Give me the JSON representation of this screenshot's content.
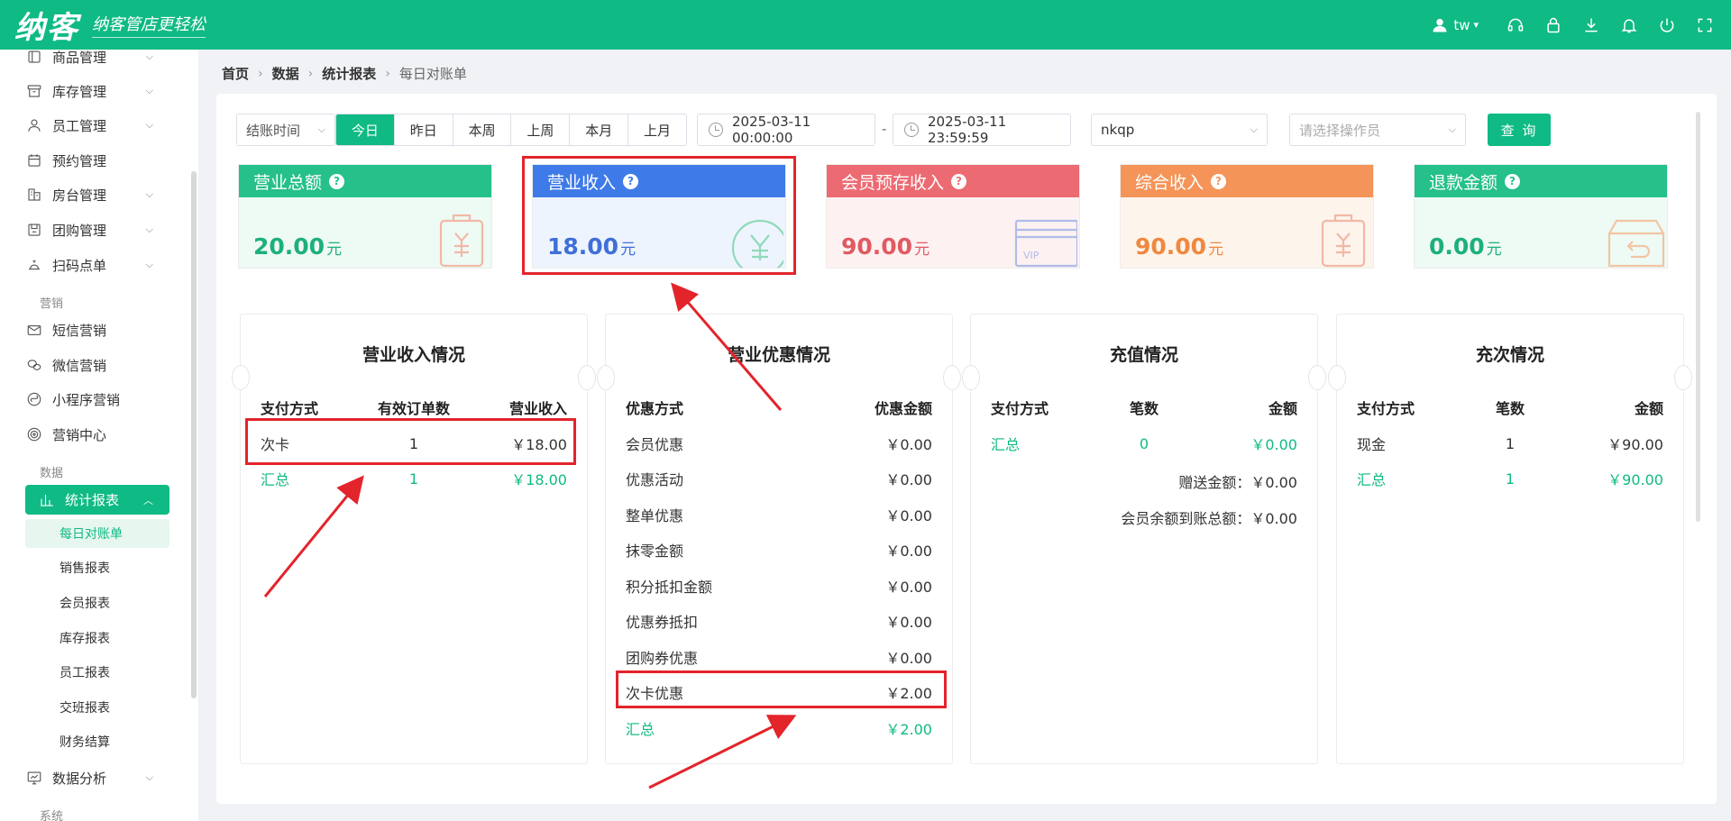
{
  "app": {
    "logo": "纳客",
    "slogan": "纳客管店更轻松",
    "user": "tw"
  },
  "sidebar": {
    "items_top": [
      {
        "label": "商品管理",
        "icon": "box-icon"
      },
      {
        "label": "库存管理",
        "icon": "warehouse-icon"
      },
      {
        "label": "员工管理",
        "icon": "user-icon"
      },
      {
        "label": "预约管理",
        "icon": "calendar-icon"
      },
      {
        "label": "房台管理",
        "icon": "building-icon"
      },
      {
        "label": "团购管理",
        "icon": "group-buy-icon"
      },
      {
        "label": "扫码点单",
        "icon": "service-bell-icon"
      }
    ],
    "section_marketing": "营销",
    "items_marketing": [
      {
        "label": "短信营销",
        "icon": "mail-icon"
      },
      {
        "label": "微信营销",
        "icon": "wechat-icon"
      },
      {
        "label": "小程序营销",
        "icon": "miniprogram-icon"
      },
      {
        "label": "营销中心",
        "icon": "target-icon"
      }
    ],
    "section_data": "数据",
    "active_item": {
      "label": "统计报表",
      "icon": "bar-chart-icon"
    },
    "sub_items": [
      "每日对账单",
      "销售报表",
      "会员报表",
      "库存报表",
      "员工报表",
      "交班报表",
      "财务结算"
    ],
    "items_after": [
      {
        "label": "数据分析",
        "icon": "monitor-chart-icon"
      }
    ],
    "section_system": "系统"
  },
  "breadcrumb": [
    "首页",
    "数据",
    "统计报表",
    "每日对账单"
  ],
  "filters": {
    "time_type": "结账时间",
    "ranges": [
      "今日",
      "昨日",
      "本周",
      "上周",
      "本月",
      "上月"
    ],
    "active_range": "今日",
    "start": "2025-03-11 00:00:00",
    "range_sep": "-",
    "end": "2025-03-11 23:59:59",
    "store": "nkqp",
    "operator_placeholder": "请选择操作员",
    "query": "查 询"
  },
  "stats": [
    {
      "label": "营业总额",
      "value": "20.00",
      "unit": "元",
      "color": "#26c08a",
      "bg": "#eefaf4",
      "text": "#1db07c"
    },
    {
      "label": "营业收入",
      "value": "18.00",
      "unit": "元",
      "color": "#3f7be8",
      "bg": "#eef4fd",
      "text": "#3f6fd8"
    },
    {
      "label": "会员预存收入",
      "value": "90.00",
      "unit": "元",
      "color": "#ec6b73",
      "bg": "#fdf1f1",
      "text": "#e05a62"
    },
    {
      "label": "综合收入",
      "value": "90.00",
      "unit": "元",
      "color": "#f59458",
      "bg": "#fdf4ec",
      "text": "#f0883f"
    },
    {
      "label": "退款金额",
      "value": "0.00",
      "unit": "元",
      "color": "#26c08a",
      "bg": "#eefaf4",
      "text": "#1db07c"
    }
  ],
  "vip_label": "VIP",
  "revenue": {
    "title": "营业收入情况",
    "headers": [
      "支付方式",
      "有效订单数",
      "营业收入"
    ],
    "rows": [
      [
        "次卡",
        "1",
        "￥18.00"
      ]
    ],
    "total": [
      "汇总",
      "1",
      "￥18.00"
    ]
  },
  "discount": {
    "title": "营业优惠情况",
    "headers": [
      "优惠方式",
      "优惠金额"
    ],
    "rows": [
      [
        "会员优惠",
        "￥0.00"
      ],
      [
        "优惠活动",
        "￥0.00"
      ],
      [
        "整单优惠",
        "￥0.00"
      ],
      [
        "抹零金额",
        "￥0.00"
      ],
      [
        "积分抵扣金额",
        "￥0.00"
      ],
      [
        "优惠券抵扣",
        "￥0.00"
      ],
      [
        "团购券优惠",
        "￥0.00"
      ],
      [
        "次卡优惠",
        "￥2.00"
      ]
    ],
    "total": [
      "汇总",
      "￥2.00"
    ]
  },
  "recharge": {
    "title": "充值情况",
    "headers": [
      "支付方式",
      "笔数",
      "金额"
    ],
    "total": [
      "汇总",
      "0",
      "￥0.00"
    ],
    "gift_line": "赠送金额：￥0.00",
    "balance_line": "会员余额到账总额：￥0.00"
  },
  "times": {
    "title": "充次情况",
    "headers": [
      "支付方式",
      "笔数",
      "金额"
    ],
    "rows": [
      [
        "现金",
        "1",
        "￥90.00"
      ]
    ],
    "total": [
      "汇总",
      "1",
      "￥90.00"
    ]
  },
  "colors": {
    "accent": "#0fba84",
    "annotation": "#e3242b"
  }
}
